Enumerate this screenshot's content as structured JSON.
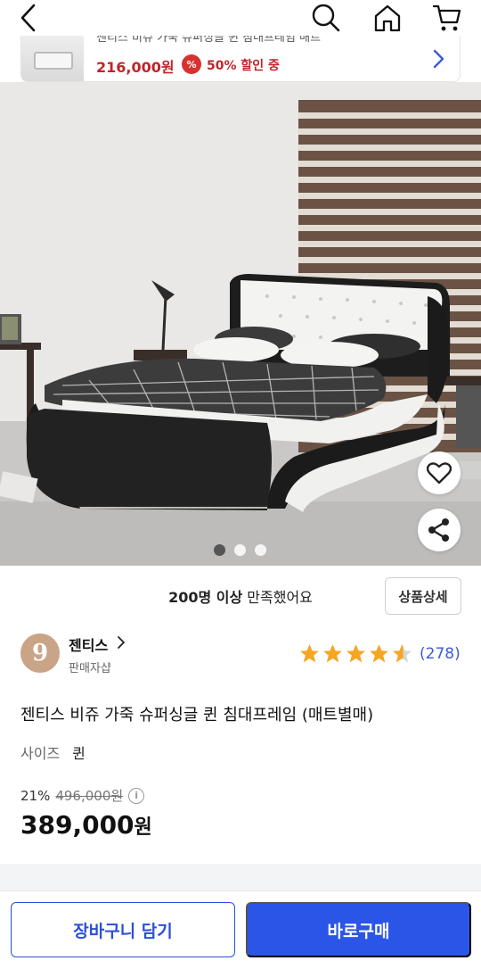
{
  "topbar": {
    "back_icon": "chevron-left-icon",
    "search_icon": "search-icon",
    "home_icon": "home-icon",
    "cart_icon": "cart-icon"
  },
  "banner": {
    "title": "젠티스 비쥬 가죽 슈퍼싱글 퀸 침대프레임 매트",
    "price": "216,000원",
    "badge": "%",
    "discount": "50% 할인 중"
  },
  "hero": {
    "page_count": 3,
    "active_page": 1
  },
  "satisfaction": {
    "strong": "200명 이상",
    "rest": " 만족했어요"
  },
  "detail_button": "상품상세",
  "seller": {
    "logo_letter": "9",
    "name": "젠티스",
    "type": "판매자샵"
  },
  "rating": {
    "stars": 4.5,
    "count": "(278)"
  },
  "product": {
    "title": "젠티스 비쥬 가죽 슈퍼싱글 퀸 침대프레임 (매트별매)",
    "option_label": "사이즈",
    "option_value": "퀸",
    "discount_rate": "21%",
    "original_price": "496,000원",
    "info_icon": "i",
    "final_price": "389,000",
    "final_unit": "원"
  },
  "bottom": {
    "cart_label": "장바구니 담기",
    "buy_label": "바로구매"
  },
  "colors": {
    "accent": "#2b55e6",
    "price_red": "#c0242b",
    "star": "#f5a623",
    "rating_count": "#3a5bd9"
  }
}
